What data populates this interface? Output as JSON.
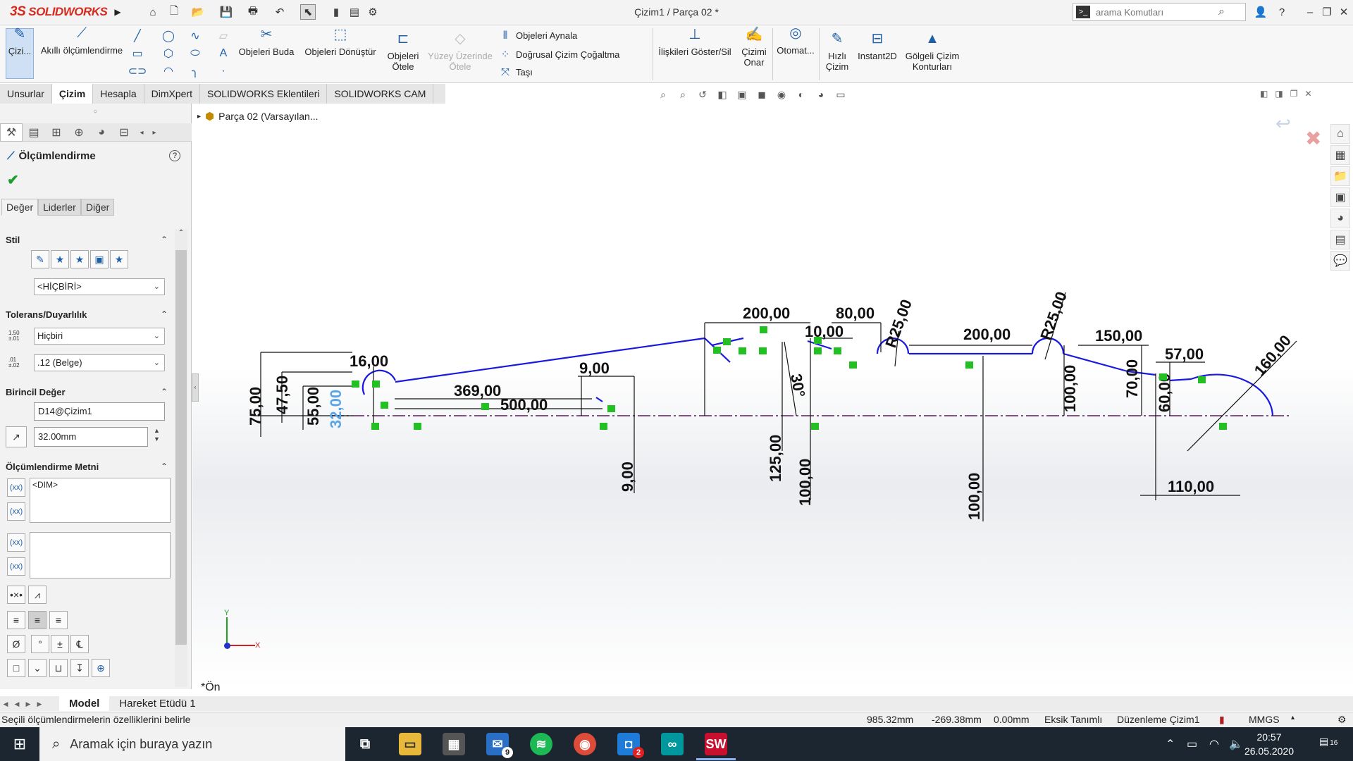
{
  "app": {
    "brand": "SOLIDWORKS",
    "brand_mark": "3S",
    "doc_title": "Çizim1 / Parça 02 *",
    "accent": "#d52b1e"
  },
  "title_icons": [
    "home-icon",
    "new-file-icon",
    "open-icon",
    "save-icon",
    "print-icon",
    "undo-icon",
    "select-icon",
    "traffic-light-icon",
    "file-properties-icon",
    "options-gear-icon"
  ],
  "search": {
    "placeholder": "arama Komutları"
  },
  "window_controls": [
    "user-icon",
    "help-icon",
    "minimize-icon",
    "restore-icon",
    "close-icon"
  ],
  "ribbon": {
    "sketch_label": "Çizi...",
    "smart_dim": "Akıllı ölçümlendirme",
    "trim": "Objeleri Buda",
    "convert": "Objeleri Dönüştür",
    "offset": "Objeleri Ötele",
    "offset_surface": "Yüzey Üzerinde Ötele",
    "mirror": "Objeleri Aynala",
    "linear_pattern": "Doğrusal Çizim Çoğaltma",
    "move": "Taşı",
    "relations": "İlişkileri Göster/Sil",
    "repair": "Çizimi Onar",
    "auto": "Otomat...",
    "rapid": "Hızlı Çizim",
    "instant2d": "Instant2D",
    "shaded": "Gölgeli Çizim Konturları"
  },
  "tabs": [
    {
      "label": "Unsurlar",
      "active": false
    },
    {
      "label": "Çizim",
      "active": true
    },
    {
      "label": "Hesapla",
      "active": false
    },
    {
      "label": "DimXpert",
      "active": false
    },
    {
      "label": "SOLIDWORKS Eklentileri",
      "active": false
    },
    {
      "label": "SOLIDWORKS CAM",
      "active": false
    }
  ],
  "property_manager": {
    "title": "Ölçümlendirme",
    "subtabs": [
      "Değer",
      "Liderler",
      "Diğer"
    ],
    "style_header": "Stil",
    "style_value": "<HİÇBİRİ>",
    "tolerance_header": "Tolerans/Duyarlılık",
    "tolerance_type": "Hiçbiri",
    "precision": ".12 (Belge)",
    "tol_icon_text": "1.50 ±.01",
    "prec_icon_text": ".01 ±.02",
    "primary_header": "Birincil Değer",
    "primary_name": "D14@Çizim1",
    "primary_value": "32.00mm",
    "text_header": "Ölçümlendirme Metni",
    "dim_text": "<DIM>",
    "symbols": [
      "Ø",
      "°",
      "±",
      "℄"
    ]
  },
  "tree": {
    "root": "Parça 02  (Varsayılan..."
  },
  "view_label": "*Ön",
  "drawing": {
    "dims": [
      "16,00",
      "75,00",
      "47,50",
      "55,00",
      "32,00",
      "369,00",
      "500,00",
      "9,00",
      "9,00",
      "200,00",
      "80,00",
      "10,00",
      "30°",
      "125,00",
      "100,00",
      "R25,00",
      "200,00",
      "100,00",
      "R25,00",
      "150,00",
      "100,00",
      "57,00",
      "70,00",
      "60,00",
      "160,00",
      "110,00"
    ],
    "line_color": "#1a1adf",
    "relation_color": "#22c022",
    "centerline_color": "#5a1a5a"
  },
  "bottom_tabs": [
    {
      "label": "Model",
      "active": true
    },
    {
      "label": "Hareket Etüdü 1",
      "active": false
    }
  ],
  "status": {
    "message": "Seçili ölçümlendirmelerin özelliklerini belirle",
    "x": "985.32mm",
    "y": "-269.38mm",
    "z": "0.00mm",
    "state": "Eksik Tanımlı",
    "editing": "Düzenleme Çizim1",
    "units": "MMGS"
  },
  "taskbar": {
    "search_placeholder": "Aramak için buraya yazın",
    "mail_badge": "9",
    "app_badge": "2",
    "time": "20:57",
    "date": "26.05.2020",
    "notifications": "16"
  }
}
